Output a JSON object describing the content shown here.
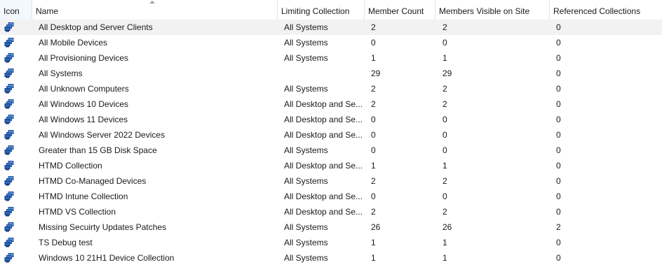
{
  "columns": {
    "icon": "Icon",
    "name": "Name",
    "limiting": "Limiting Collection",
    "member_count": "Member Count",
    "visible": "Members Visible on Site",
    "referenced": "Referenced Collections"
  },
  "icon_name": "device-collection-icon",
  "rows": [
    {
      "name": "All Desktop and Server Clients",
      "limiting": "All Systems",
      "member_count": "2",
      "visible": "2",
      "referenced": "0"
    },
    {
      "name": "All Mobile Devices",
      "limiting": "All Systems",
      "member_count": "0",
      "visible": "0",
      "referenced": "0"
    },
    {
      "name": "All Provisioning Devices",
      "limiting": "All Systems",
      "member_count": "1",
      "visible": "1",
      "referenced": "0"
    },
    {
      "name": "All Systems",
      "limiting": "",
      "member_count": "29",
      "visible": "29",
      "referenced": "0"
    },
    {
      "name": "All Unknown Computers",
      "limiting": "All Systems",
      "member_count": "2",
      "visible": "2",
      "referenced": "0"
    },
    {
      "name": "All Windows 10 Devices",
      "limiting": "All Desktop and Se...",
      "member_count": "2",
      "visible": "2",
      "referenced": "0"
    },
    {
      "name": "All Windows 11 Devices",
      "limiting": "All Desktop and Se...",
      "member_count": "0",
      "visible": "0",
      "referenced": "0"
    },
    {
      "name": "All Windows Server 2022 Devices",
      "limiting": "All Desktop and Se...",
      "member_count": "0",
      "visible": "0",
      "referenced": "0"
    },
    {
      "name": "Greater than 15 GB Disk Space",
      "limiting": "All Systems",
      "member_count": "0",
      "visible": "0",
      "referenced": "0"
    },
    {
      "name": "HTMD Collection",
      "limiting": "All Desktop and Se...",
      "member_count": "1",
      "visible": "1",
      "referenced": "0"
    },
    {
      "name": "HTMD Co-Managed Devices",
      "limiting": "All Systems",
      "member_count": "2",
      "visible": "2",
      "referenced": "0"
    },
    {
      "name": "HTMD Intune Collection",
      "limiting": "All Desktop and Se...",
      "member_count": "0",
      "visible": "0",
      "referenced": "0"
    },
    {
      "name": "HTMD VS Collection",
      "limiting": "All Desktop and Se...",
      "member_count": "2",
      "visible": "2",
      "referenced": "0"
    },
    {
      "name": "Missing Secuirty Updates Patches",
      "limiting": "All Systems",
      "member_count": "26",
      "visible": "26",
      "referenced": "2"
    },
    {
      "name": "TS Debug test",
      "limiting": "All Systems",
      "member_count": "1",
      "visible": "1",
      "referenced": "0"
    },
    {
      "name": "Windows 10 21H1 Device Collection",
      "limiting": "All Systems",
      "member_count": "1",
      "visible": "1",
      "referenced": "0"
    }
  ]
}
